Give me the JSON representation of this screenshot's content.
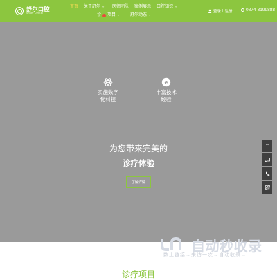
{
  "header": {
    "logo": {
      "name": "舒尔口腔",
      "sub": "Shuer Dental"
    },
    "nav_row1": [
      {
        "label": "首页",
        "chevron": false,
        "active": true
      },
      {
        "label": "关于舒尔",
        "chevron": true,
        "active": false
      },
      {
        "label": "医师团队",
        "chevron": false,
        "active": false
      },
      {
        "label": "案例展示",
        "chevron": false,
        "active": false
      },
      {
        "label": "口腔知识",
        "chevron": true,
        "active": false
      }
    ],
    "nav_row2": [
      {
        "label": "诊",
        "suffix": "项目",
        "hot": true,
        "chevron": true
      },
      {
        "label": "舒尔动态",
        "chevron": true
      }
    ],
    "login": "登录",
    "register": "注册",
    "phone": "0874-3199888",
    "colors": {
      "brand": "#8cc63f",
      "hot": "#e84c3d"
    }
  },
  "hero": {
    "features": [
      {
        "line1": "实施数字",
        "line2": "化科技",
        "icon": "atom-icon"
      },
      {
        "line1": "丰富技术",
        "line2": "经验",
        "icon": "e-badge-icon"
      }
    ],
    "headline1": "为您带来完美的",
    "headline2": "诊疗体验",
    "button": "了解详情",
    "background": "#9a9a9a"
  },
  "side_tools": [
    "chevron-up-icon",
    "chat-icon",
    "phone-icon",
    "qr-icon"
  ],
  "watermark": {
    "big": "自动秒收录",
    "small": "数上链接→来访一次→自动收录→"
  },
  "section": {
    "title": "诊疗项目"
  }
}
